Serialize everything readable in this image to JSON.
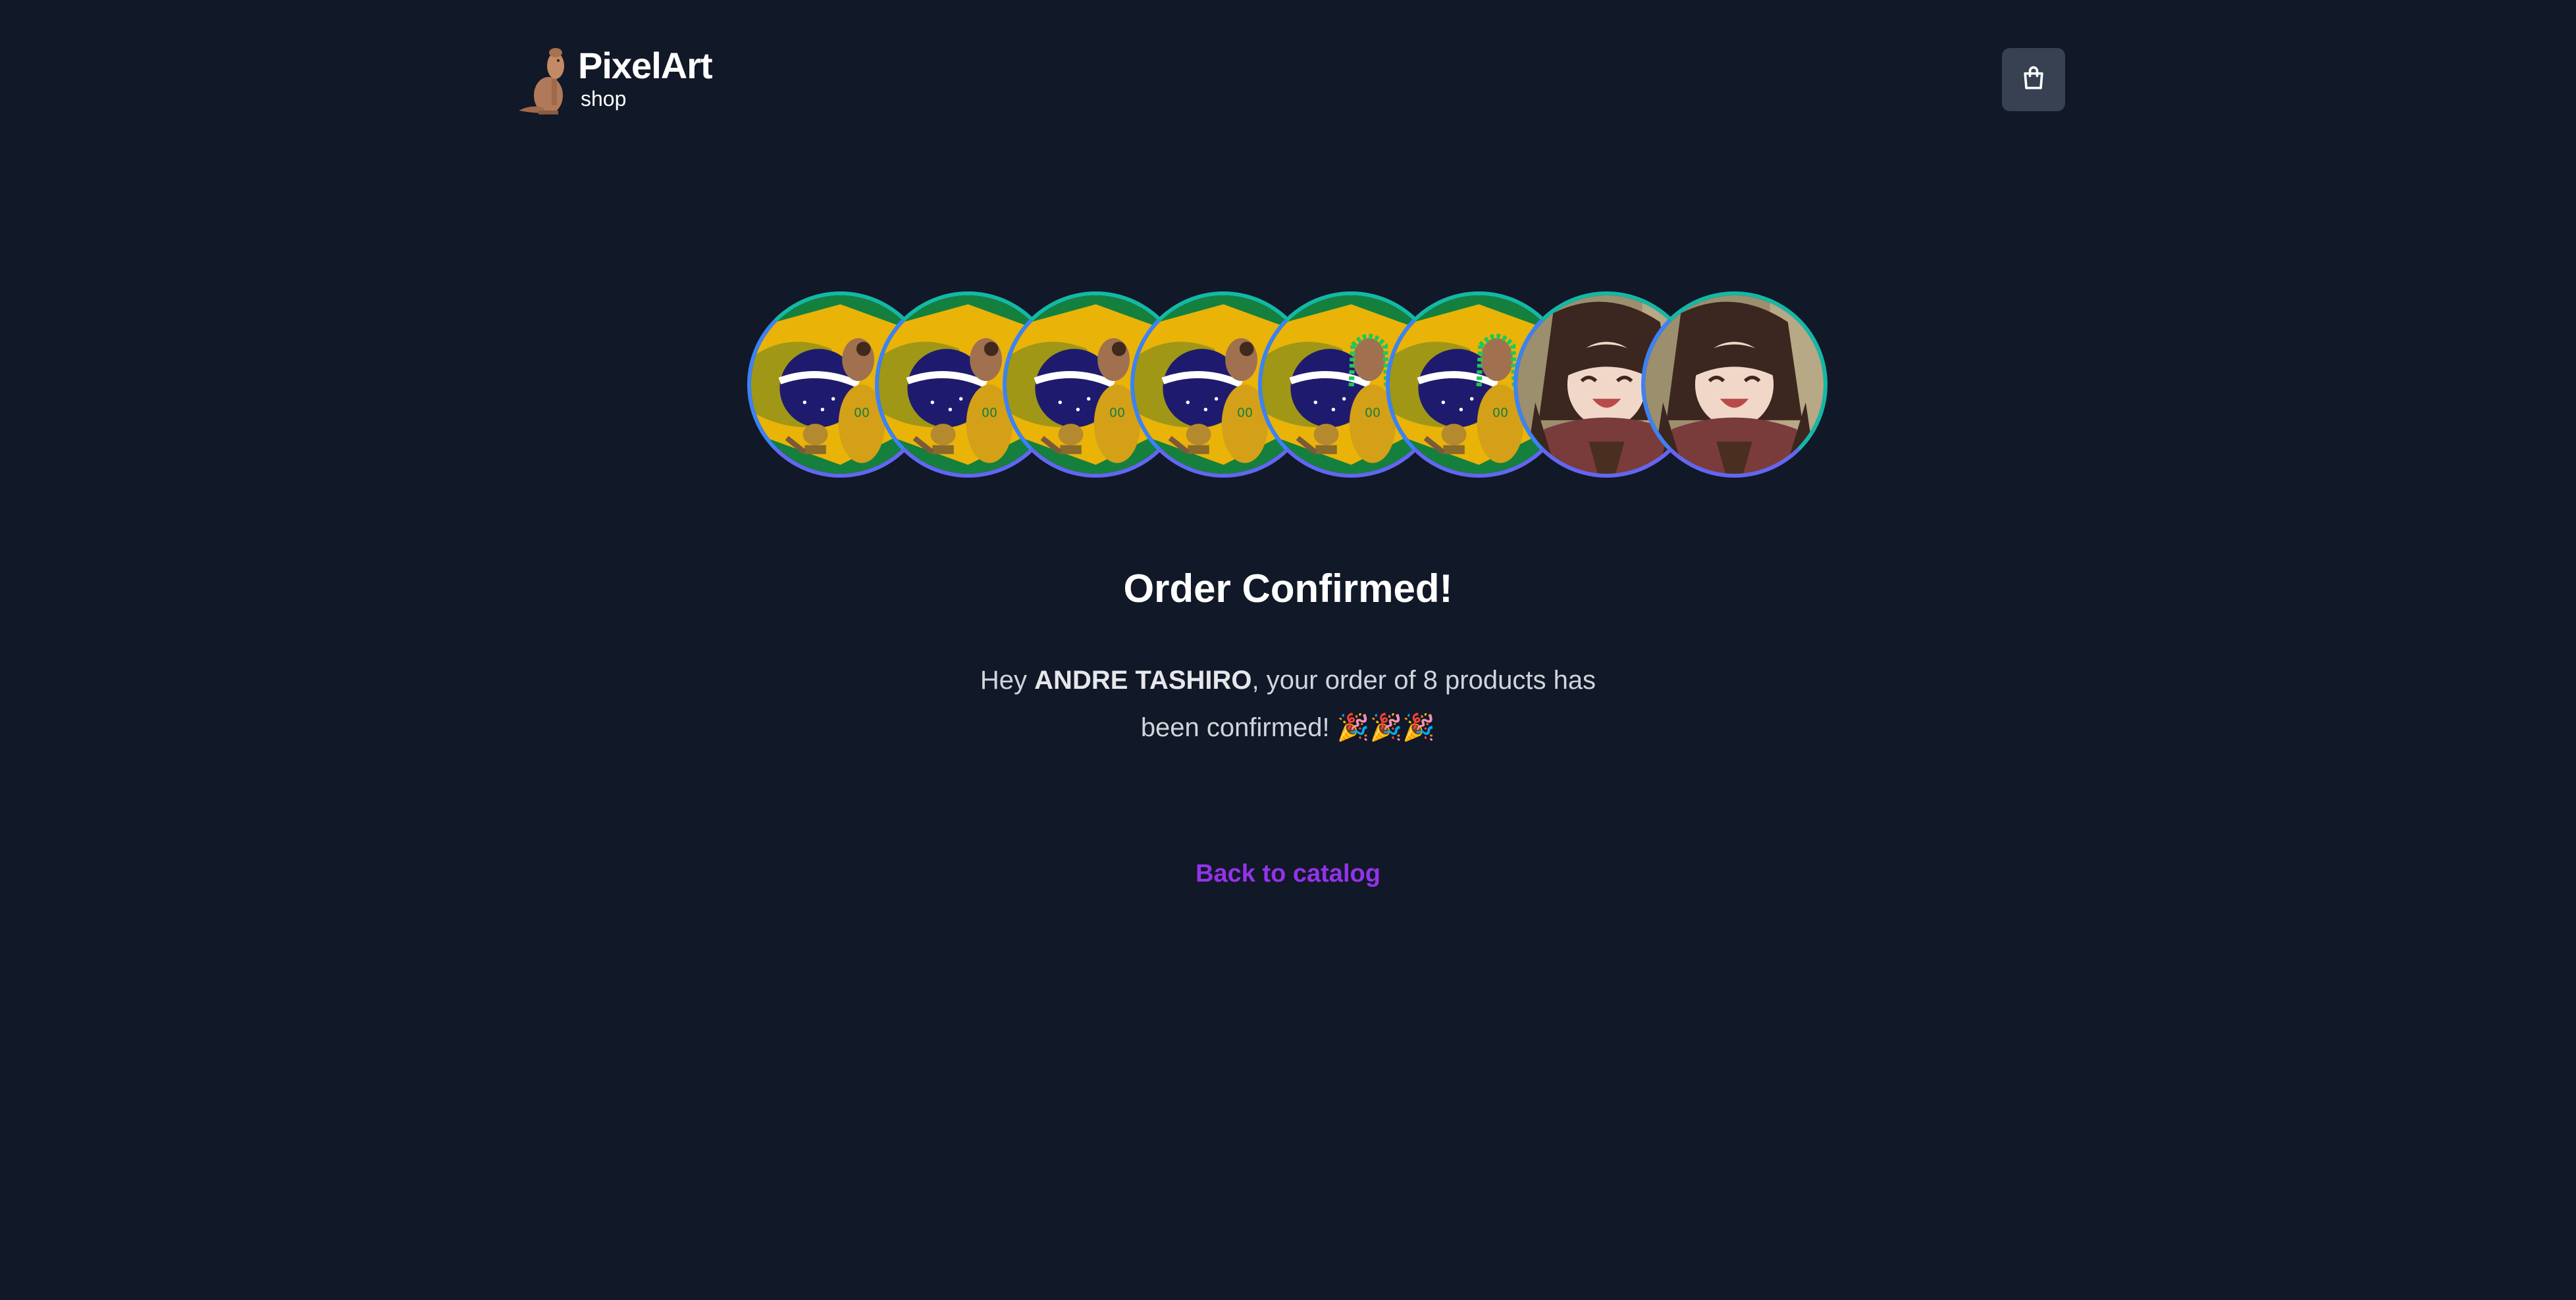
{
  "header": {
    "logo_title": "PixelArt",
    "logo_subtitle": "shop",
    "logo_icon": "capybara-icon",
    "cart_icon": "shopping-bag-icon"
  },
  "order": {
    "products": [
      {
        "name": "capybara-brazil-flag-avatar",
        "art": "capybara"
      },
      {
        "name": "capybara-brazil-flag-avatar",
        "art": "capybara"
      },
      {
        "name": "capybara-brazil-flag-avatar",
        "art": "capybara"
      },
      {
        "name": "capybara-brazil-flag-avatar",
        "art": "capybara"
      },
      {
        "name": "capybara-brazil-flag-avatar",
        "art": "capybara-braids"
      },
      {
        "name": "capybara-brazil-flag-avatar",
        "art": "capybara-braids"
      },
      {
        "name": "anime-girl-avatar",
        "art": "anime"
      },
      {
        "name": "anime-girl-avatar",
        "art": "anime"
      }
    ],
    "title": "Order Confirmed!",
    "message_prefix": "Hey ",
    "customer_name": "ANDRE TASHIRO",
    "message_middle": ", your order of ",
    "product_count": "8",
    "message_suffix": " products has been confirmed! 🎉🎉🎉",
    "back_link": "Back to catalog"
  },
  "colors": {
    "background": "#111827",
    "accent": "#9333ea",
    "ring_top": "#14b8a6",
    "ring_bottom": "#6366f1",
    "cart_bg": "#374151"
  }
}
